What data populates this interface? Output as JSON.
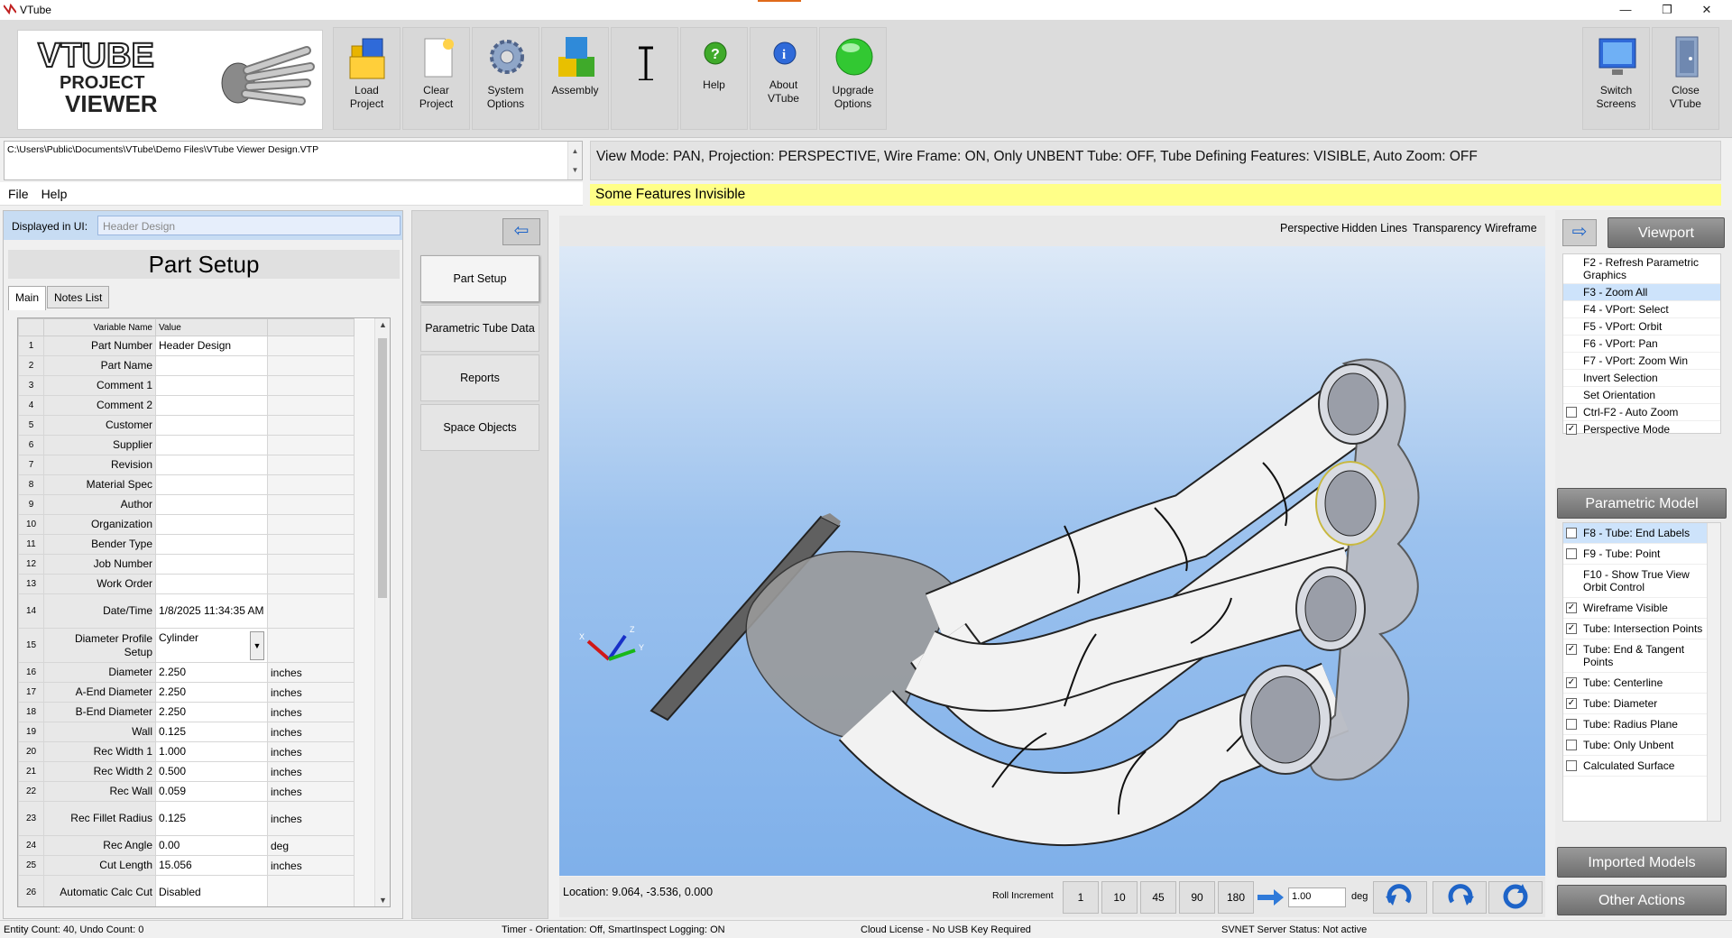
{
  "window": {
    "title": "VTube"
  },
  "ribbon": {
    "logo": {
      "line1": "VTUBE",
      "line2": "PROJECT",
      "line3": "VIEWER"
    },
    "buttons": [
      {
        "label": "Load\nProject",
        "icon": "folder-icon"
      },
      {
        "label": "Clear\nProject",
        "icon": "new-document-icon"
      },
      {
        "label": "System\nOptions",
        "icon": "gear-icon"
      },
      {
        "label": "Assembly",
        "icon": "cubes-icon"
      },
      {
        "label": "",
        "icon": "text-cursor-icon"
      },
      {
        "label": "Help",
        "icon": "help-icon"
      },
      {
        "label": "About\nVTube",
        "icon": "info-icon"
      },
      {
        "label": "Upgrade\nOptions",
        "icon": "green-orb-icon"
      }
    ],
    "right_buttons": [
      {
        "label": "Switch\nScreens",
        "icon": "monitor-icon"
      },
      {
        "label": "Close\nVTube",
        "icon": "door-exit-icon"
      }
    ]
  },
  "path": "C:\\Users\\Public\\Documents\\VTube\\Demo Files\\VTube Viewer Design.VTP",
  "view_mode": "View Mode: PAN, Projection: PERSPECTIVE, Wire Frame: ON, Only UNBENT Tube: OFF, Tube Defining Features: VISIBLE, Auto Zoom: OFF",
  "notice": "Some Features Invisible",
  "menu": [
    "File",
    "Help"
  ],
  "left": {
    "displayed_label": "Displayed in UI:",
    "displayed_value": "Header Design",
    "title": "Part Setup",
    "tabs": [
      "Main",
      "Notes List"
    ],
    "grid_headers": [
      "Variable Name",
      "Value"
    ],
    "rows": [
      {
        "n": "1",
        "name": "Part Number",
        "value": "Header Design",
        "unit": ""
      },
      {
        "n": "2",
        "name": "Part Name",
        "value": "",
        "unit": ""
      },
      {
        "n": "3",
        "name": "Comment 1",
        "value": "",
        "unit": ""
      },
      {
        "n": "4",
        "name": "Comment 2",
        "value": "",
        "unit": ""
      },
      {
        "n": "5",
        "name": "Customer",
        "value": "",
        "unit": ""
      },
      {
        "n": "6",
        "name": "Supplier",
        "value": "",
        "unit": ""
      },
      {
        "n": "7",
        "name": "Revision",
        "value": "",
        "unit": ""
      },
      {
        "n": "8",
        "name": "Material Spec",
        "value": "",
        "unit": ""
      },
      {
        "n": "9",
        "name": "Author",
        "value": "",
        "unit": ""
      },
      {
        "n": "10",
        "name": "Organization",
        "value": "",
        "unit": ""
      },
      {
        "n": "11",
        "name": "Bender Type",
        "value": "",
        "unit": ""
      },
      {
        "n": "12",
        "name": "Job Number",
        "value": "",
        "unit": ""
      },
      {
        "n": "13",
        "name": "Work Order",
        "value": "",
        "unit": ""
      },
      {
        "n": "14",
        "name": "Date/Time",
        "value": "1/8/2025 11:34:35 AM",
        "unit": ""
      },
      {
        "n": "15",
        "name": "Diameter Profile Setup",
        "value": "Cylinder",
        "unit": ""
      },
      {
        "n": "16",
        "name": "Diameter",
        "value": "2.250",
        "unit": "inches"
      },
      {
        "n": "17",
        "name": "A-End Diameter",
        "value": "2.250",
        "unit": "inches"
      },
      {
        "n": "18",
        "name": "B-End Diameter",
        "value": "2.250",
        "unit": "inches"
      },
      {
        "n": "19",
        "name": "Wall",
        "value": "0.125",
        "unit": "inches"
      },
      {
        "n": "20",
        "name": "Rec Width 1",
        "value": "1.000",
        "unit": "inches"
      },
      {
        "n": "21",
        "name": "Rec Width 2",
        "value": "0.500",
        "unit": "inches"
      },
      {
        "n": "22",
        "name": "Rec Wall",
        "value": "0.059",
        "unit": "inches"
      },
      {
        "n": "23",
        "name": "Rec Fillet Radius",
        "value": "0.125",
        "unit": "inches"
      },
      {
        "n": "24",
        "name": "Rec Angle",
        "value": "0.00",
        "unit": "deg"
      },
      {
        "n": "25",
        "name": "Cut Length",
        "value": "15.056",
        "unit": "inches"
      },
      {
        "n": "26",
        "name": "Automatic Calc Cut",
        "value": "Disabled",
        "unit": ""
      }
    ]
  },
  "nav": [
    "Part Setup",
    "Parametric Tube Data",
    "Reports",
    "Space Objects"
  ],
  "viewport": {
    "tools": [
      "Perspective",
      "Hidden Lines",
      "Transparency",
      "Wireframe"
    ],
    "axes": {
      "x": "X",
      "y": "Y",
      "z": "Z"
    },
    "location": "Location: 9.064, -3.536, 0.000",
    "roll_label": "Roll Increment",
    "roll_buttons": [
      "1",
      "10",
      "45",
      "90",
      "180"
    ],
    "roll_value": "1.00",
    "roll_unit": "deg"
  },
  "right": {
    "viewport_header": "Viewport",
    "viewport_items": [
      {
        "label": "F2 - Refresh Parametric Graphics",
        "checkbox": false,
        "checked": false,
        "selected": false
      },
      {
        "label": "F3 - Zoom All",
        "checkbox": false,
        "checked": false,
        "selected": true
      },
      {
        "label": "F4 - VPort: Select",
        "checkbox": false,
        "checked": false,
        "selected": false
      },
      {
        "label": "F5 - VPort: Orbit",
        "checkbox": false,
        "checked": false,
        "selected": false
      },
      {
        "label": "F6 - VPort: Pan",
        "checkbox": false,
        "checked": false,
        "selected": false
      },
      {
        "label": "F7 - VPort: Zoom Win",
        "checkbox": false,
        "checked": false,
        "selected": false
      },
      {
        "label": "Invert Selection",
        "checkbox": false,
        "checked": false,
        "selected": false
      },
      {
        "label": "Set Orientation",
        "checkbox": false,
        "checked": false,
        "selected": false
      },
      {
        "label": "Ctrl-F2 - Auto Zoom",
        "checkbox": true,
        "checked": false,
        "selected": false
      },
      {
        "label": "Perspective Mode",
        "checkbox": true,
        "checked": true,
        "selected": false
      }
    ],
    "param_header": "Parametric Model",
    "param_items": [
      {
        "label": "F8 - Tube: End Labels",
        "checked": false,
        "selected": true
      },
      {
        "label": "F9 - Tube: Point",
        "checked": false,
        "selected": false
      },
      {
        "label": "F10 - Show True View Orbit Control",
        "checked": null,
        "selected": false
      },
      {
        "label": "Wireframe Visible",
        "checked": true,
        "selected": false
      },
      {
        "label": "Tube: Intersection Points",
        "checked": true,
        "selected": false
      },
      {
        "label": "Tube: End & Tangent Points",
        "checked": true,
        "selected": false
      },
      {
        "label": "Tube: Centerline",
        "checked": true,
        "selected": false
      },
      {
        "label": "Tube: Diameter",
        "checked": true,
        "selected": false
      },
      {
        "label": "Tube: Radius Plane",
        "checked": false,
        "selected": false
      },
      {
        "label": "Tube: Only Unbent",
        "checked": false,
        "selected": false
      },
      {
        "label": "Calculated Surface",
        "checked": false,
        "selected": false
      }
    ],
    "imported_header": "Imported Models",
    "other_header": "Other Actions"
  },
  "status": {
    "entity": "Entity Count: 40, Undo Count: 0",
    "timer": "Timer - Orientation: Off, SmartInspect Logging: ON",
    "license": "Cloud License - No USB Key Required",
    "server": "SVNET Server Status: Not active"
  }
}
